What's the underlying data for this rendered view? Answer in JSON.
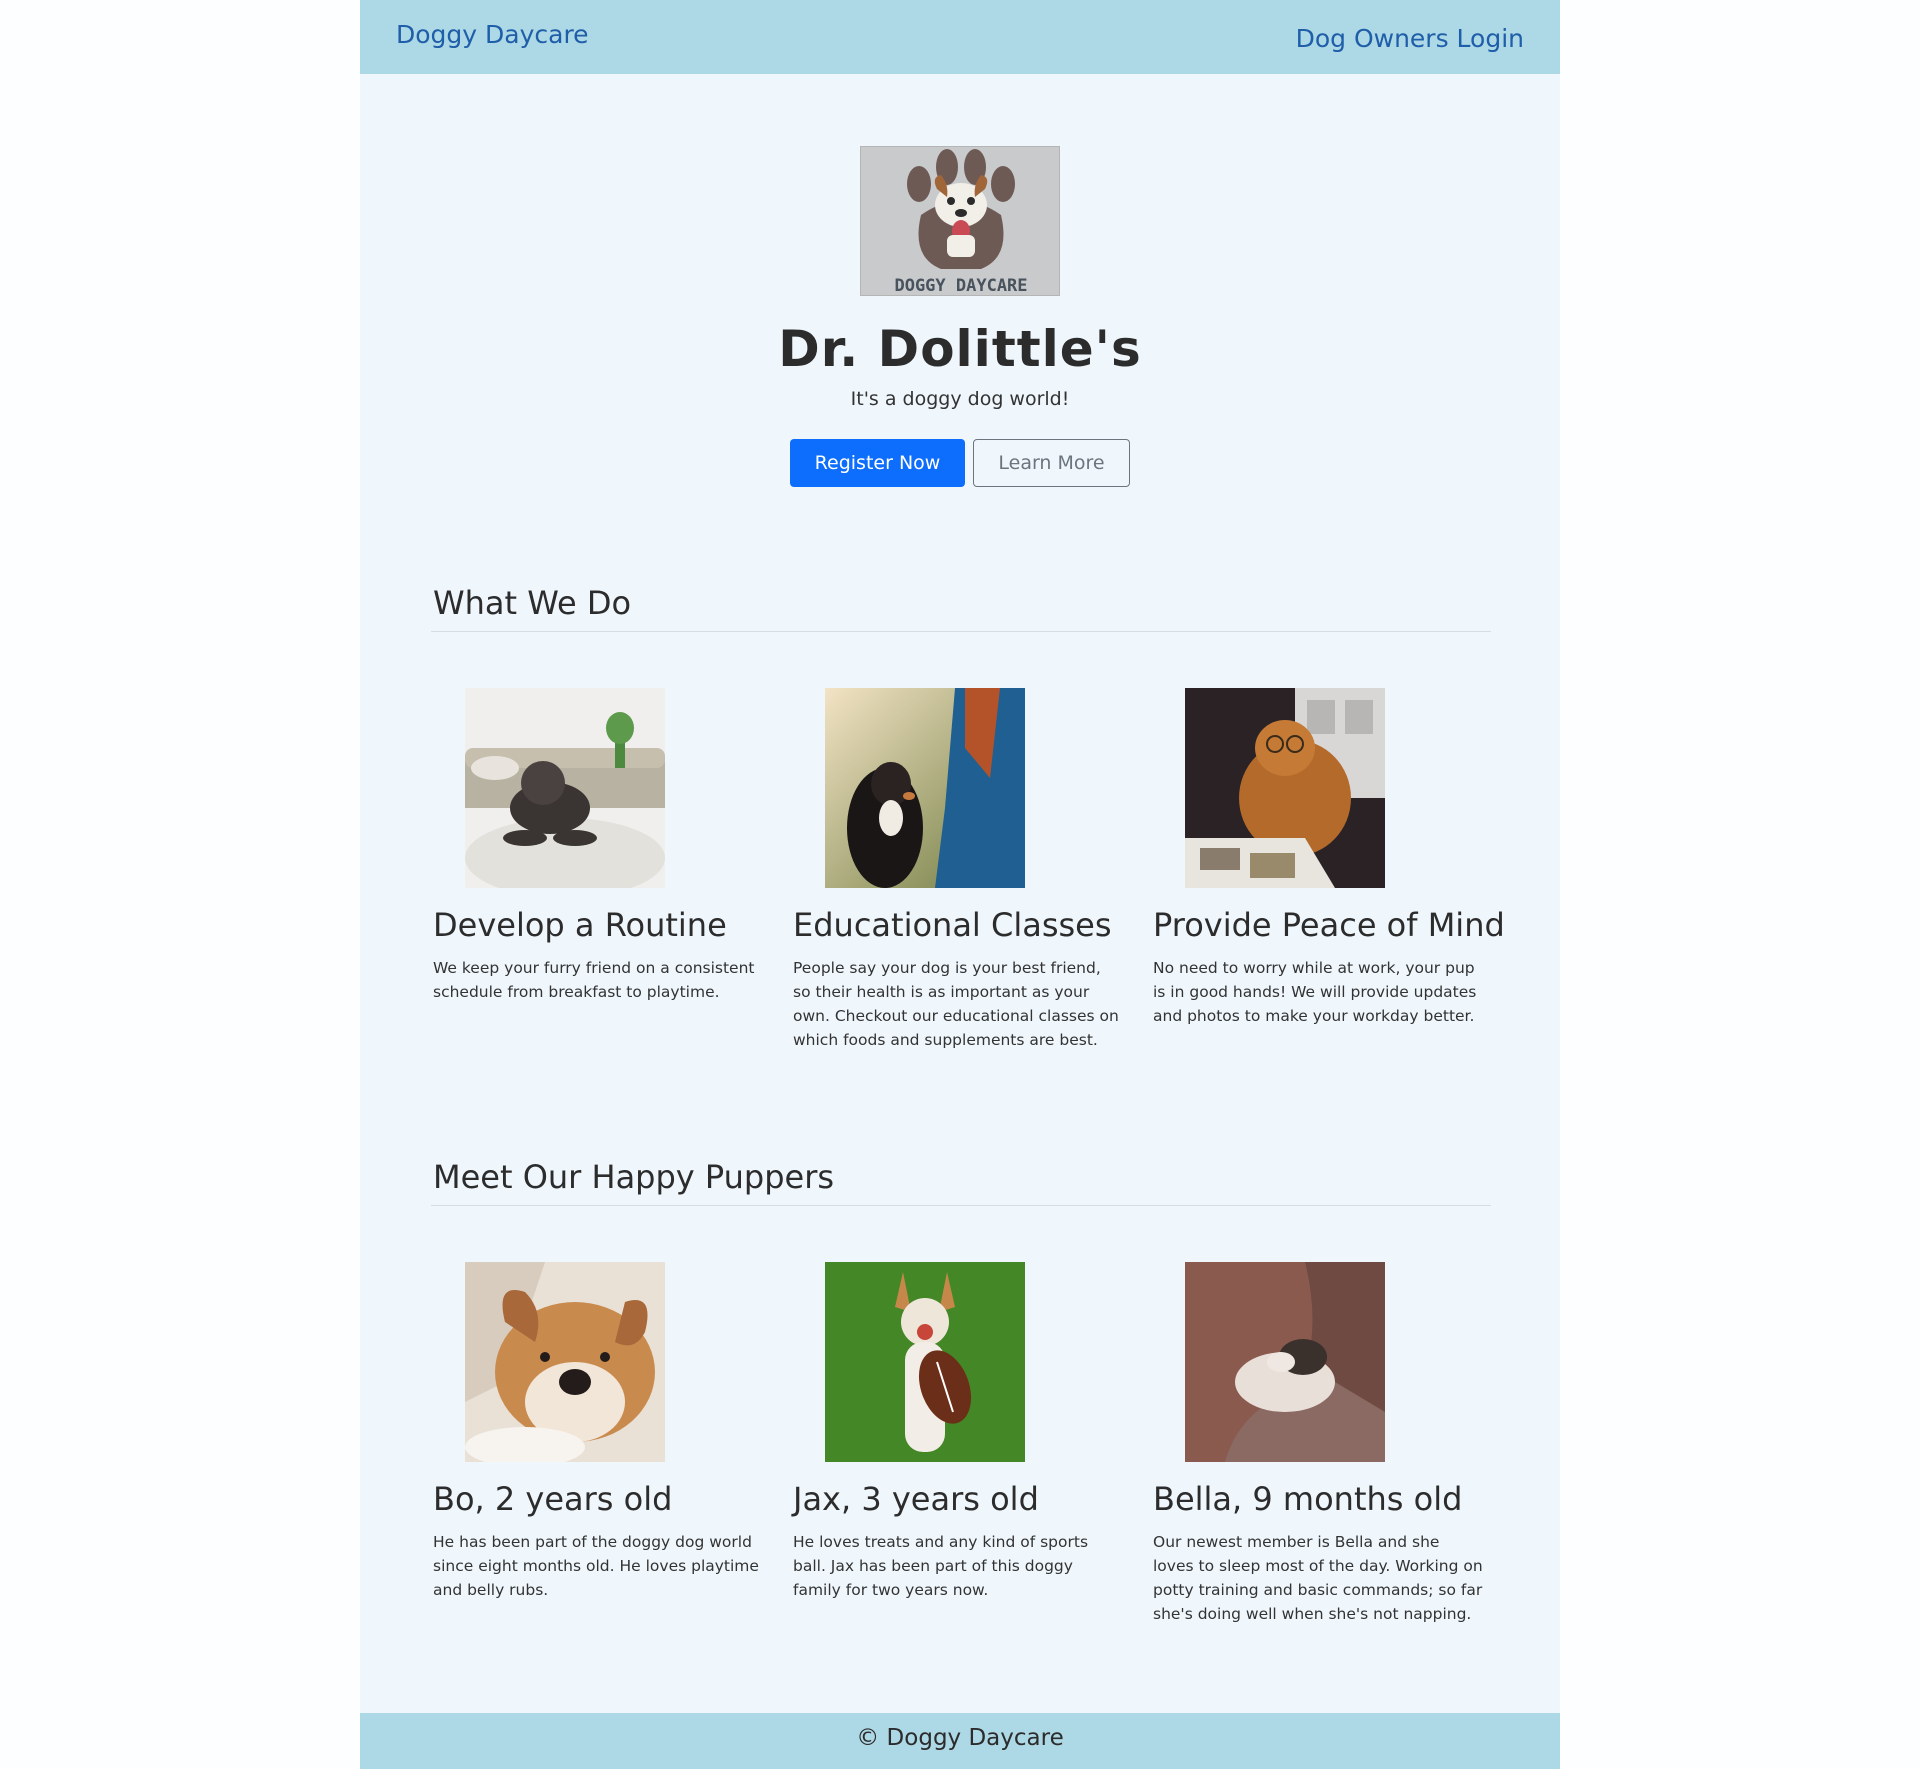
{
  "nav": {
    "brand": "Doggy Daycare",
    "login": "Dog Owners Login"
  },
  "hero": {
    "logo_text": "DOGGY DAYCARE",
    "title": "Dr. Dolittle's",
    "subtitle": "It's a doggy dog world!",
    "primary_button": "Register Now",
    "secondary_button": "Learn More"
  },
  "what_we_do": {
    "heading": "What We Do",
    "cards": [
      {
        "title": "Develop a Routine",
        "text": "We keep your furry friend on a consistent schedule from breakfast to playtime."
      },
      {
        "title": "Educational Classes",
        "text": "People say your dog is your best friend, so their health is as important as your own. Checkout our educational classes on which foods and supplements are best."
      },
      {
        "title": "Provide Peace of Mind",
        "text": "No need to worry while at work, your pup is in good hands! We will provide updates and photos to make your workday better."
      }
    ]
  },
  "puppers": {
    "heading": "Meet Our Happy Puppers",
    "cards": [
      {
        "title": "Bo, 2 years old",
        "text": "He has been part of the doggy dog world since eight months old. He loves playtime and belly rubs."
      },
      {
        "title": "Jax, 3 years old",
        "text": "He loves treats and any kind of sports ball. Jax has been part of this doggy family for two years now."
      },
      {
        "title": "Bella, 9 months old",
        "text": "Our newest member is Bella and she loves to sleep most of the day. Working on potty training and basic commands; so far she's doing well when she's not napping."
      }
    ]
  },
  "footer": {
    "text": "© Doggy Daycare"
  },
  "colors": {
    "navbar": "#add8e6",
    "page_bg": "#eff7fd",
    "primary": "#0d6efd",
    "link": "#1f5ea8"
  }
}
